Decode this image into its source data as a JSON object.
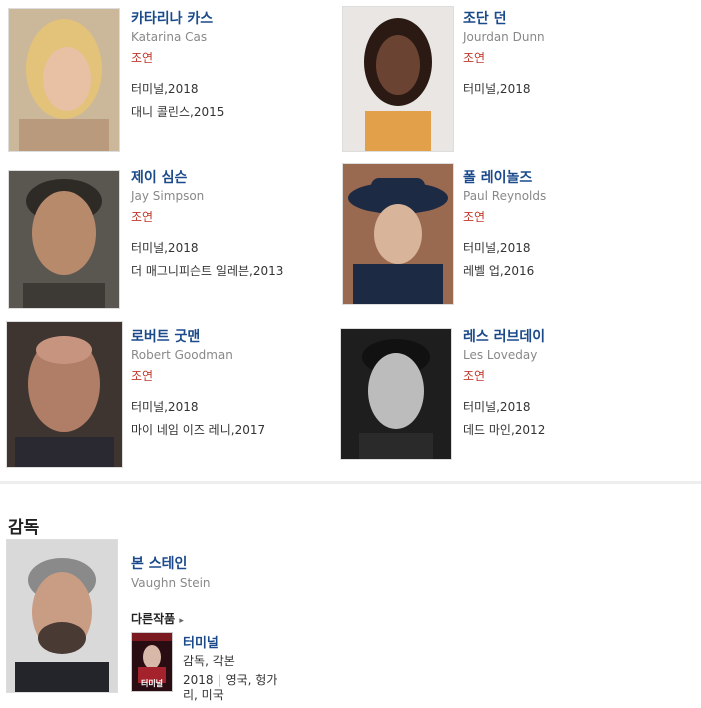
{
  "cast": [
    {
      "name_ko": "카타리나 카스",
      "name_en": "Katarina Cas",
      "role": "조연",
      "works": [
        "터미널,2018",
        "대니 콜린스,2015"
      ]
    },
    {
      "name_ko": "조단 던",
      "name_en": "Jourdan Dunn",
      "role": "조연",
      "works": [
        "터미널,2018"
      ]
    },
    {
      "name_ko": "제이 심슨",
      "name_en": "Jay Simpson",
      "role": "조연",
      "works": [
        "터미널,2018",
        "더 매그니피슨트 일레븐,2013"
      ]
    },
    {
      "name_ko": "폴 레이놀즈",
      "name_en": "Paul Reynolds",
      "role": "조연",
      "works": [
        "터미널,2018",
        "레벨 업,2016"
      ]
    },
    {
      "name_ko": "로버트 굿맨",
      "name_en": "Robert Goodman",
      "role": "조연",
      "works": [
        "터미널,2018",
        "마이 네임 이즈 레니,2017"
      ]
    },
    {
      "name_ko": "레스 러브데이",
      "name_en": "Les Loveday",
      "role": "조연",
      "works": [
        "터미널,2018",
        "데드 마인,2012"
      ]
    }
  ],
  "director_section": {
    "title": "감독",
    "name_ko": "본 스테인",
    "name_en": "Vaughn Stein",
    "more_works_label": "다른작품",
    "film": {
      "title": "터미널",
      "credit": "감독, 각본",
      "year": "2018",
      "country_line1": "영국, 헝가",
      "country_line2": "리, 미국",
      "poster_text": "터미널"
    }
  }
}
